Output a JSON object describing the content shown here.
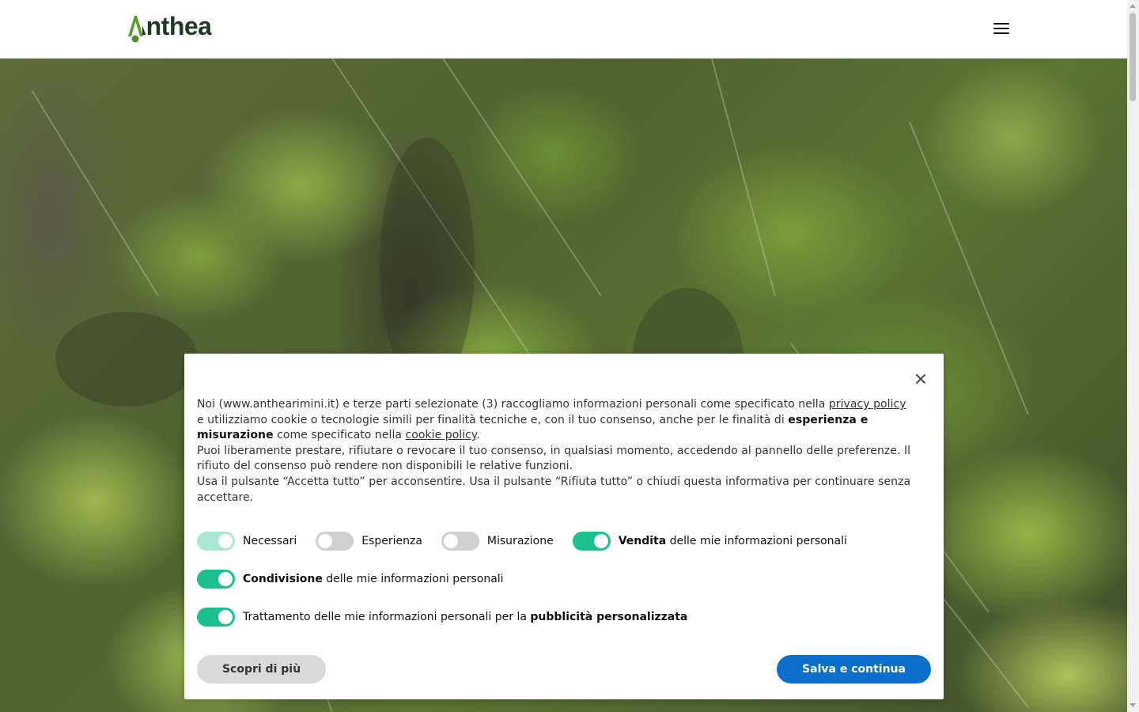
{
  "header": {
    "logo_text": "Anthea",
    "logo_colors": {
      "text": "#1f3a22",
      "accent": "#5a9e2b"
    },
    "menu_icon": "hamburger-icon"
  },
  "hero": {
    "description_icon": "forest-aerial-image"
  },
  "consent": {
    "close_icon": "close-icon",
    "paragraph1": {
      "t1": "Noi (www.anthearimini.it) e terze parti selezionate (3) raccogliamo informazioni personali come specificato nella ",
      "privacy_link": "privacy policy",
      "t2": " e utilizziamo cookie o tecnologie simili per finalità tecniche e, con il tuo consenso, anche per le finalità di ",
      "bold1": "esperienza e misurazione",
      "t3": " come specificato nella ",
      "cookie_link": "cookie policy",
      "t4": "."
    },
    "paragraph2": "Puoi liberamente prestare, rifiutare o revocare il tuo consenso, in qualsiasi momento, accedendo al pannello delle preferenze. Il rifiuto del consenso può rendere non disponibili le relative funzioni.",
    "paragraph3": "Usa il pulsante “Accetta tutto” per acconsentire. Usa il pulsante “Rifiuta tutto” o chiudi questa informativa per continuare senza accettare.",
    "toggles": {
      "necessari": {
        "label": "Necessari",
        "state": "on-disabled"
      },
      "esperienza": {
        "label": "Esperienza",
        "state": "off"
      },
      "misurazione": {
        "label": "Misurazione",
        "state": "off"
      },
      "vendita": {
        "bold": "Vendita",
        "rest": " delle mie informazioni personali",
        "state": "on"
      },
      "condivisione": {
        "bold": "Condivisione",
        "rest": " delle mie informazioni personali",
        "state": "on"
      },
      "trattamento": {
        "rest": "Trattamento delle mie informazioni personali per la ",
        "bold": "pubblicità personalizzata",
        "state": "on"
      }
    },
    "buttons": {
      "more": "Scopri di più",
      "save": "Salva e continua"
    },
    "colors": {
      "toggle_on": "#1cbf8f",
      "toggle_off": "#d0d0d0",
      "primary_button": "#0b6fcb"
    }
  }
}
